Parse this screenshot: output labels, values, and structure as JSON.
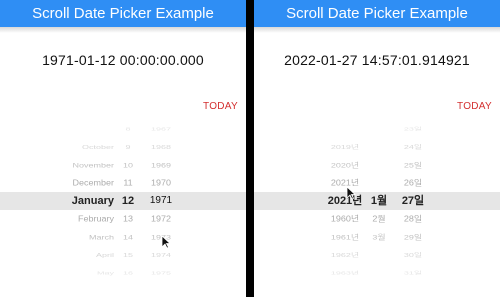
{
  "app_title": "Scroll Date Picker Example",
  "left": {
    "datetime": "1971-01-12 00:00:00.000",
    "today_label": "TODAY",
    "months": [
      "October",
      "November",
      "December",
      "January",
      "February",
      "March",
      "April",
      "May"
    ],
    "days": [
      "8",
      "9",
      "10",
      "11",
      "12",
      "13",
      "14",
      "15",
      "16"
    ],
    "years": [
      "1967",
      "1968",
      "1969",
      "1970",
      "1971",
      "1972",
      "1973",
      "1974",
      "1975"
    ]
  },
  "right": {
    "datetime": "2022-01-27 14:57:01.914921",
    "today_label": "TODAY",
    "years": [
      "2019년",
      "2020년",
      "2021년",
      "2021년",
      "1960년",
      "1961년",
      "1962년",
      "1963년"
    ],
    "months": [
      "1월",
      "2월",
      "3월"
    ],
    "days": [
      "23일",
      "24일",
      "25일",
      "26일",
      "27일",
      "28일",
      "29일",
      "30일",
      "31일"
    ]
  }
}
